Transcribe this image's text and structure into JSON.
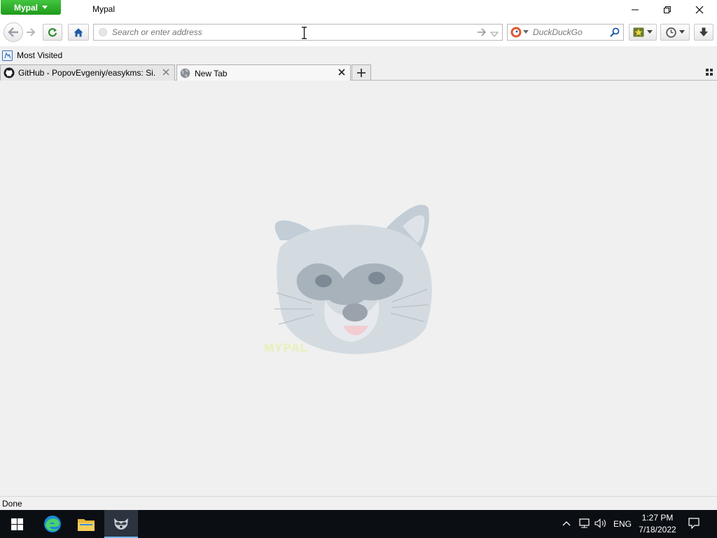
{
  "window": {
    "app_menu_label": "Mypal",
    "title": "Mypal"
  },
  "navbar": {
    "url_placeholder": "Search or enter address",
    "search_engine": "DuckDuckGo",
    "search_placeholder": "DuckDuckGo"
  },
  "bookmarks": {
    "items": [
      {
        "label": "Most Visited",
        "icon": "bookmark-folder-icon"
      }
    ]
  },
  "tabs": [
    {
      "title": "GitHub - PopovEvgeniy/easykms: Si...",
      "icon": "github-icon",
      "active": false
    },
    {
      "title": "New Tab",
      "icon": "globe-icon",
      "active": true
    }
  ],
  "content": {
    "image": "raccoon-logo",
    "watermark_text": "MYPAL"
  },
  "statusbar": {
    "text": "Done"
  },
  "taskbar": {
    "items": [
      "start-button",
      "edge-icon",
      "file-explorer-icon",
      "mypal-icon"
    ],
    "language": "ENG",
    "time": "1:27 PM",
    "date": "7/18/2022"
  },
  "colors": {
    "app_menu_green": "#2fb12b",
    "taskbar_bg": "#0b0f14",
    "content_bg": "#f0f0f0"
  }
}
